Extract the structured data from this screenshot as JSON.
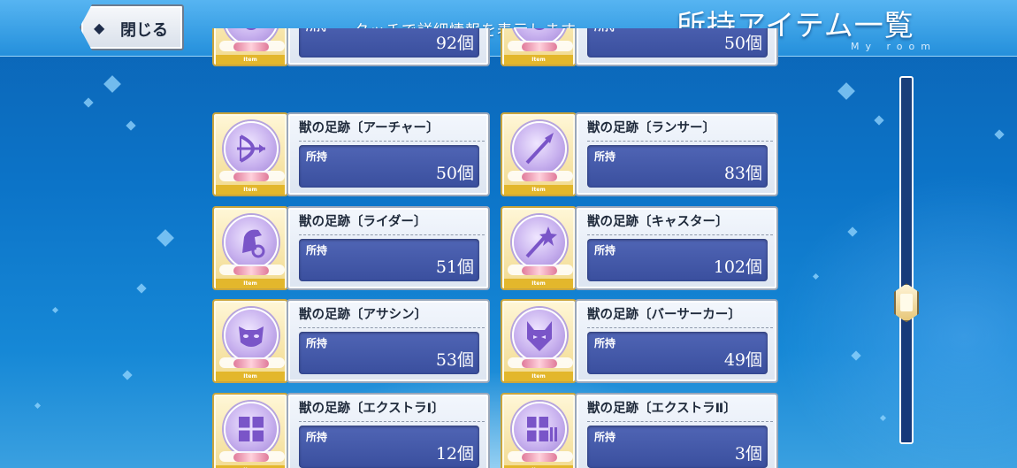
{
  "header": {
    "close_label": "閉じる",
    "hint": "タッチで詳細情報を表示します。",
    "title": "所持アイテム一覧",
    "subtitle": "My room"
  },
  "item_tag": "Item",
  "own_label": "所持",
  "rows": [
    [
      {
        "name": "",
        "count": "92個",
        "icon": "paw-icon"
      },
      {
        "name": "",
        "count": "50個",
        "icon": "paw-icon"
      }
    ],
    [
      {
        "name": "獣の足跡〔アーチャー〕",
        "count": "50個",
        "icon": "bow-icon"
      },
      {
        "name": "獣の足跡〔ランサー〕",
        "count": "83個",
        "icon": "spear-icon"
      }
    ],
    [
      {
        "name": "獣の足跡〔ライダー〕",
        "count": "51個",
        "icon": "horse-icon"
      },
      {
        "name": "獣の足跡〔キャスター〕",
        "count": "102個",
        "icon": "staff-icon"
      }
    ],
    [
      {
        "name": "獣の足跡〔アサシン〕",
        "count": "53個",
        "icon": "mask-icon"
      },
      {
        "name": "獣の足跡〔バーサーカー〕",
        "count": "49個",
        "icon": "wolf-icon"
      }
    ],
    [
      {
        "name": "獣の足跡〔エクストラⅠ〕",
        "count": "12個",
        "icon": "extra-one-icon"
      },
      {
        "name": "獣の足跡〔エクストラⅡ〕",
        "count": "3個",
        "icon": "extra-two-icon"
      }
    ]
  ],
  "scroll": {
    "position": 0.63
  },
  "colors": {
    "accent": "#3a4f9e",
    "item_gold": "#e3b72c",
    "background": "#0c74c8"
  }
}
